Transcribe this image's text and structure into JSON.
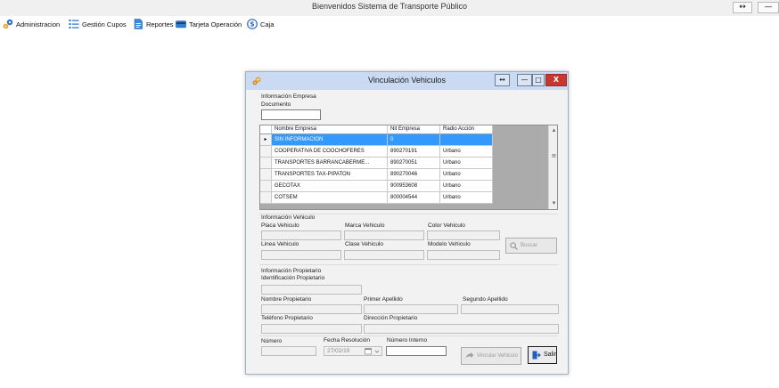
{
  "window": {
    "title": "Bienvenidos Sistema de Transporte Público",
    "restore_glyph": "↔",
    "minimize_glyph": "—"
  },
  "menu": [
    {
      "label": "Administracion",
      "icon": "gears-icon"
    },
    {
      "label": "Gestión Cupos",
      "icon": "list-icon"
    },
    {
      "label": "Reportes",
      "icon": "document-icon"
    },
    {
      "label": "Tarjeta Operación",
      "icon": "card-icon"
    },
    {
      "label": "Caja",
      "icon": "cash-icon"
    }
  ],
  "dialog": {
    "title": "Vinculación Vehiculos",
    "buttons": {
      "expand": "↔",
      "minimize": "—",
      "maximize": "□",
      "close": "X"
    },
    "empresa": {
      "section_title": "Información Empresa",
      "documento_label": "Documento",
      "documento_value": ""
    },
    "grid": {
      "columns": [
        "Nombre Empresa",
        "Nit Empresa",
        "Radio Acción"
      ],
      "selected_marker": "▸",
      "rows": [
        [
          "SIN INFORMACION",
          "0",
          ""
        ],
        [
          "COOPERATIVA DE COOCHOFERES",
          "890270191",
          "Urbano"
        ],
        [
          "TRANSPORTES BARRANCABERME...",
          "890270051",
          "Urbano"
        ],
        [
          "TRANSPORTES TAX-PIPATON",
          "890270046",
          "Urbano"
        ],
        [
          "GECOTAX",
          "900953608",
          "Urbano"
        ],
        [
          "COTSEM",
          "800004544",
          "Urbano"
        ]
      ],
      "scroll_up": "▴",
      "scroll_mid": "≡",
      "scroll_down": "▾"
    },
    "vehiculo": {
      "section_title": "Información Vehiculo",
      "placa_label": "Placa Vehiculo",
      "marca_label": "Marca Vehiculo",
      "color_label": "Color Vehiculo",
      "linea_label": "Linea Vehiculo",
      "clase_label": "Clase Vehiculo",
      "modelo_label": "Modelo Vehiculo",
      "buscar_label": "Buscar"
    },
    "propietario": {
      "section_title": "Información Propietario",
      "identificacion_label": "Identificación Propietario",
      "nombre_label": "Nombre Propietario",
      "primer_apellido_label": "Primer Apellido",
      "segundo_apellido_label": "Segundo Apellido",
      "telefono_label": "Teléfono Propietario",
      "direccion_label": "Dirección Propietario"
    },
    "footer": {
      "numero_label": "Número",
      "fecha_label": "Fecha Resolución",
      "fecha_value": "27/02/19",
      "numero_interno_label": "Número Interno",
      "vincular_label": "Vincular Vehiculo",
      "salir_label": "Salir"
    }
  },
  "colors": {
    "selection": "#3399ff",
    "dialog_title_bar": "#c9daf2",
    "close_button": "#c7372f",
    "disabled_field": "#f0f0f0"
  }
}
